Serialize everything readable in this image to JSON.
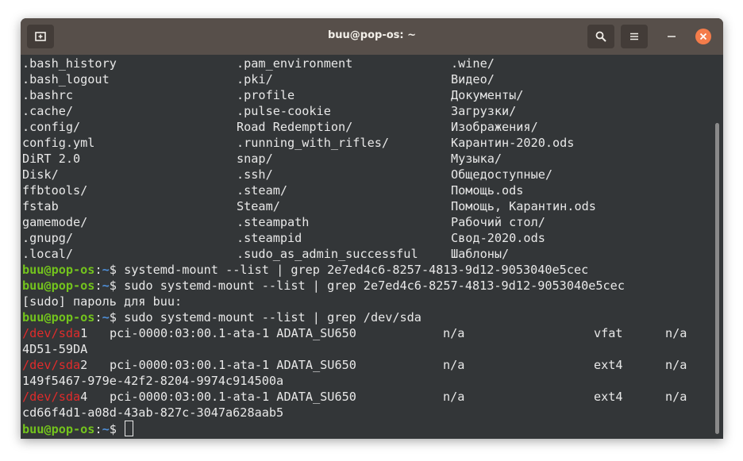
{
  "window": {
    "title": "buu@pop-os: ~"
  },
  "prompt": {
    "user_host": "buu@pop-os",
    "sep": ":",
    "path": "~",
    "symbol": "$"
  },
  "listing": [
    [
      ".bash_history",
      ".pam_environment",
      ".wine/"
    ],
    [
      ".bash_logout",
      ".pki/",
      "Видео/"
    ],
    [
      ".bashrc",
      ".profile",
      "Документы/"
    ],
    [
      ".cache/",
      ".pulse-cookie",
      "Загрузки/"
    ],
    [
      ".config/",
      "Road Redemption/",
      "Изображения/"
    ],
    [
      "config.yml",
      ".running_with_rifles/",
      "Карантин-2020.ods"
    ],
    [
      "DiRT 2.0",
      "snap/",
      "Музыка/"
    ],
    [
      "Disk/",
      ".ssh/",
      "Общедоступные/"
    ],
    [
      "ffbtools/",
      ".steam/",
      "Помощь.ods"
    ],
    [
      "fstab",
      "Steam/",
      "Помощь, Карантин.ods"
    ],
    [
      "gamemode/",
      ".steampath",
      "Рабочий стол/"
    ],
    [
      ".gnupg/",
      ".steampid",
      "Свод-2020.ods"
    ],
    [
      ".local/",
      ".sudo_as_admin_successful",
      "Шаблоны/"
    ]
  ],
  "commands": [
    "systemd-mount --list | grep 2e7ed4c6-8257-4813-9d12-9053040e5cec",
    "sudo systemd-mount --list | grep 2e7ed4c6-8257-4813-9d12-9053040e5cec"
  ],
  "sudo_prompt": "[sudo] пароль для buu:",
  "command3": "sudo systemd-mount --list | grep /dev/sda",
  "devices": [
    {
      "dev": "/dev/sda",
      "num": "1",
      "path": "pci-0000:03:00.1-ata-1 ADATA_SU650",
      "label": "n/a",
      "fs": "vfat",
      "opt": "n/a",
      "uuid": "4D51-59DA"
    },
    {
      "dev": "/dev/sda",
      "num": "2",
      "path": "pci-0000:03:00.1-ata-1 ADATA_SU650",
      "label": "n/a",
      "fs": "ext4",
      "opt": "n/a",
      "uuid": "149f5467-979e-42f2-8204-9974c914500a"
    },
    {
      "dev": "/dev/sda",
      "num": "4",
      "path": "pci-0000:03:00.1-ata-1 ADATA_SU650",
      "label": "n/a",
      "fs": "ext4",
      "opt": "n/a",
      "uuid": "cd66f4d1-a08d-43ab-827c-3047a628aab5"
    }
  ],
  "icons": {
    "new_tab": "new-tab-icon",
    "search": "search-icon",
    "menu": "hamburger-menu-icon",
    "minimize": "minimize-icon",
    "close": "close-icon"
  },
  "colors": {
    "titlebar": "#574f4a",
    "terminal_bg": "#333638",
    "text": "#e8e8e8",
    "prompt_user": "#73c31d",
    "prompt_path": "#4f8fd8",
    "highlight": "#e02b2b",
    "close": "#f47c4a"
  }
}
